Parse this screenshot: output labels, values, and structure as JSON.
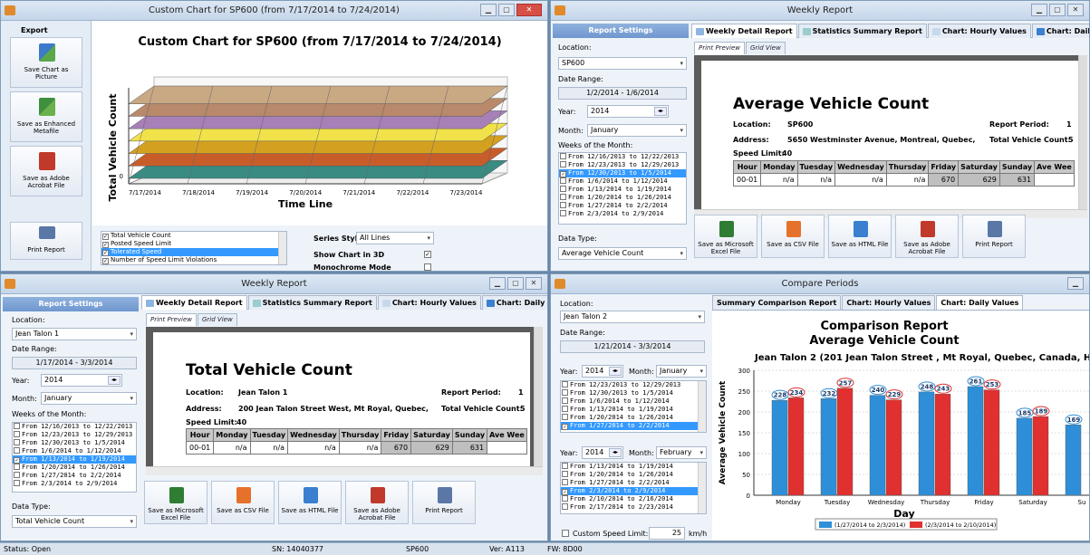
{
  "chart_win": {
    "title": "Custom Chart for SP600 (from 7/17/2014 to 7/24/2014)",
    "export_label": "Export",
    "buttons": [
      "Save Chart as Picture",
      "Save as Enhanced Metafile",
      "Save as Adobe Acrobat File",
      "Print Report"
    ],
    "series_items": [
      "Total Vehicle Count",
      "Posted Speed Limit",
      "Tolerated Speed",
      "Number of Speed Limit Violations",
      "Number of Vehicles Respecting Limit",
      "Number of Vehicles inside Tolerated Range"
    ],
    "series_style_label": "Series Style:",
    "series_style_value": "All Lines",
    "opt_3d": "Show Chart in 3D",
    "opt_mono": "Monochrome Mode",
    "opt_legend": "Show Legend"
  },
  "chart_data": [
    {
      "type": "area",
      "title": "Custom Chart for SP600 (from 7/17/2014 to 7/24/2014)",
      "xlabel": "Time Line",
      "ylabel": "Total Vehicle Count",
      "categories": [
        "7/17/2014",
        "7/18/2014",
        "7/19/2014",
        "7/20/2014",
        "7/21/2014",
        "7/22/2014",
        "7/23/2014"
      ],
      "y_ticks": [
        "0"
      ],
      "series_colors": [
        "#3a8c82",
        "#c85d2a",
        "#d4a020",
        "#f2e24a",
        "#a880b8",
        "#b8896a",
        "#c9a884"
      ]
    },
    {
      "type": "bar",
      "title": "Comparison Report",
      "subtitle": "Average Vehicle Count",
      "subtitle2": "Jean Talon 2 (201 Jean Talon Street , Mt Royal, Quebec, Canada, H3",
      "xlabel": "Day",
      "ylabel": "Average Vehicle Count",
      "ylim": [
        0,
        300
      ],
      "y_ticks": [
        0,
        50,
        100,
        150,
        200,
        250,
        300
      ],
      "categories": [
        "Monday",
        "Tuesday",
        "Wednesday",
        "Thursday",
        "Friday",
        "Saturday",
        "Su"
      ],
      "series": [
        {
          "name": "(1/27/2014 to 2/3/2014)",
          "color": "#2e8fd8",
          "values": [
            228,
            232,
            240,
            248,
            261,
            185,
            169
          ]
        },
        {
          "name": "(2/3/2014 to 2/10/2014)",
          "color": "#e03030",
          "values": [
            234,
            257,
            229,
            243,
            253,
            189,
            null
          ]
        }
      ]
    }
  ],
  "weekly_tr": {
    "title": "Weekly Report",
    "settings_header": "Report Settings",
    "location_label": "Location:",
    "location": "SP600",
    "daterange_label": "Date Range:",
    "daterange": "1/2/2014 - 1/6/2014",
    "year_label": "Year:",
    "year": "2014",
    "month_label": "Month:",
    "month": "January",
    "weeks_label": "Weeks of the Month:",
    "weeks": [
      "From 12/16/2013 to 12/22/2013",
      "From 12/23/2013 to 12/29/2013",
      "From 12/30/2013 to 1/5/2014",
      "From 1/6/2014 to 1/12/2014",
      "From 1/13/2014 to 1/19/2014",
      "From 1/20/2014 to 1/26/2014",
      "From 1/27/2014 to 2/2/2014",
      "From 2/3/2014 to 2/9/2014"
    ],
    "datatype_label": "Data Type:",
    "datatype": "Average Vehicle Count",
    "tabs": [
      "Weekly Detail Report",
      "Statistics Summary Report",
      "Chart: Hourly Values",
      "Chart: Daily V"
    ],
    "subtabs": [
      "Print Preview",
      "Grid View"
    ],
    "report_title": "Average Vehicle Count",
    "loc_label": "Location:",
    "loc_value": "SP600",
    "addr_label": "Address:",
    "addr_value": "5650 Westminster Avenue, Montreal, Quebec,",
    "speed_label": "Speed Limit:",
    "speed_value": "40",
    "period_label": "Report Period:",
    "period_value": "1",
    "total_label": "Total Vehicle Count:",
    "total_value": "5",
    "table_headers": [
      "Hour",
      "Monday",
      "Tuesday",
      "Wednesday",
      "Thursday",
      "Friday",
      "Saturday",
      "Sunday",
      "Ave Wee"
    ],
    "row": [
      "00-01",
      "n/a",
      "n/a",
      "n/a",
      "n/a",
      "670",
      "629",
      "631",
      ""
    ],
    "buttons": [
      "Save as Microsoft Excel File",
      "Save as CSV File",
      "Save as HTML File",
      "Save as Adobe Acrobat File",
      "Print Report"
    ]
  },
  "weekly_bl": {
    "title": "Weekly Report",
    "settings_header": "Report Settings",
    "location_label": "Location:",
    "location": "Jean Talon 1",
    "daterange_label": "Date Range:",
    "daterange": "1/17/2014 - 3/3/2014",
    "year_label": "Year:",
    "year": "2014",
    "month_label": "Month:",
    "month": "January",
    "weeks_label": "Weeks of the Month:",
    "weeks": [
      "From 12/16/2013 to 12/22/2013",
      "From 12/23/2013 to 12/29/2013",
      "From 12/30/2013 to 1/5/2014",
      "From 1/6/2014 to 1/12/2014",
      "From 1/13/2014 to 1/19/2014",
      "From 1/20/2014 to 1/26/2014",
      "From 1/27/2014 to 2/2/2014",
      "From 2/3/2014 to 2/9/2014"
    ],
    "datatype_label": "Data Type:",
    "datatype": "Total Vehicle Count",
    "tabs": [
      "Weekly Detail Report",
      "Statistics Summary Report",
      "Chart: Hourly Values",
      "Chart: Daily V"
    ],
    "subtabs": [
      "Print Preview",
      "Grid View"
    ],
    "report_title": "Total Vehicle Count",
    "loc_label": "Location:",
    "loc_value": "Jean Talon 1",
    "addr_label": "Address:",
    "addr_value": "200 Jean Talon Street West, Mt Royal, Quebec,",
    "speed_label": "Speed Limit:",
    "speed_value": "40",
    "period_label": "Report Period:",
    "period_value": "1",
    "total_label": "Total Vehicle Count:",
    "total_value": "5",
    "table_headers": [
      "Hour",
      "Monday",
      "Tuesday",
      "Wednesday",
      "Thursday",
      "Friday",
      "Saturday",
      "Sunday",
      "Ave Wee"
    ],
    "row": [
      "00-01",
      "n/a",
      "n/a",
      "n/a",
      "n/a",
      "670",
      "629",
      "631",
      ""
    ],
    "buttons": [
      "Save as Microsoft Excel File",
      "Save as CSV File",
      "Save as HTML File",
      "Save as Adobe Acrobat File",
      "Print Report"
    ]
  },
  "compare": {
    "title": "Compare Periods",
    "location_label": "Location:",
    "location": "Jean Talon 2",
    "daterange_label": "Date Range:",
    "daterange": "1/21/2014 - 3/3/2014",
    "year_label": "Year:",
    "year1": "2014",
    "month_label": "Month:",
    "month1": "January",
    "weeks1": [
      "From 12/23/2013 to 12/29/2013",
      "From 12/30/2013 to 1/5/2014",
      "From 1/6/2014 to 1/12/2014",
      "From 1/13/2014 to 1/19/2014",
      "From 1/20/2014 to 1/26/2014",
      "From 1/27/2014 to 2/2/2014"
    ],
    "year2": "2014",
    "month2": "February",
    "weeks2": [
      "From 1/13/2014 to 1/19/2014",
      "From 1/20/2014 to 1/26/2014",
      "From 1/27/2014 to 2/2/2014",
      "From 2/3/2014 to 2/9/2014",
      "From 2/10/2014 to 2/16/2014",
      "From 2/17/2014 to 2/23/2014"
    ],
    "custom_label": "Custom Speed Limit:",
    "custom_value": "25",
    "custom_unit": "km/h",
    "tabs": [
      "Summary Comparison Report",
      "Chart: Hourly Values",
      "Chart: Daily Values"
    ]
  },
  "status": {
    "status": "Status: Open",
    "sn": "SN: 14040377",
    "device": "SP600",
    "ver": "Ver: A113",
    "fw": "FW: 8D00"
  },
  "icons": {
    "app": "app-icon",
    "excel": "excel-icon",
    "csv": "csv-icon",
    "html": "html-icon",
    "pdf": "pdf-icon",
    "print": "printer-icon"
  },
  "colors": {
    "accent": "#6f97cf",
    "selection": "#3399ff",
    "bar_blue": "#2e8fd8",
    "bar_red": "#e03030"
  }
}
